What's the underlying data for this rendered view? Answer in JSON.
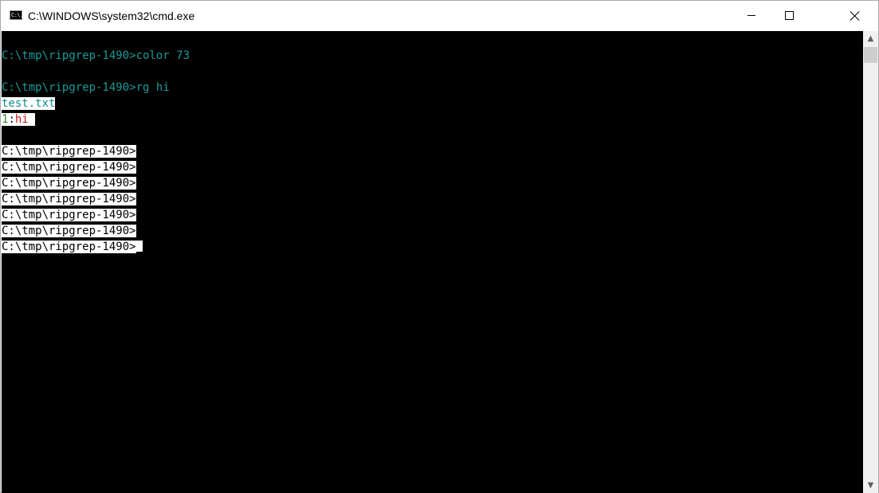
{
  "window": {
    "title": "C:\\WINDOWS\\system32\\cmd.exe",
    "icon": "cmd-icon",
    "icon_text": "C:\\.",
    "minimize_icon": "minimize-icon",
    "maximize_icon": "maximize-icon",
    "close_icon": "close-icon"
  },
  "console": {
    "colors": {
      "background": "#000000",
      "foreground_teal": "#1a9a9a",
      "inverted_background": "#ffffff",
      "line_number_green": "#2e8b2e",
      "match_red": "#d01a1a"
    },
    "lines": {
      "cmd1": "C:\\tmp\\ripgrep-1490>color 73",
      "cmd2": "C:\\tmp\\ripgrep-1490>rg hi",
      "filename": "test.txt",
      "match_line_number": "1",
      "match_sep": ":",
      "match_text": "hi",
      "prompt1": "C:\\tmp\\ripgrep-1490>",
      "prompt2": "C:\\tmp\\ripgrep-1490>",
      "prompt3": "C:\\tmp\\ripgrep-1490>",
      "prompt4": "C:\\tmp\\ripgrep-1490>",
      "prompt5": "C:\\tmp\\ripgrep-1490>",
      "prompt6": "C:\\tmp\\ripgrep-1490>",
      "prompt7": "C:\\tmp\\ripgrep-1490>"
    }
  },
  "scrollbar": {
    "up_arrow": "scroll-up-arrow-icon",
    "down_arrow": "scroll-down-arrow-icon"
  }
}
